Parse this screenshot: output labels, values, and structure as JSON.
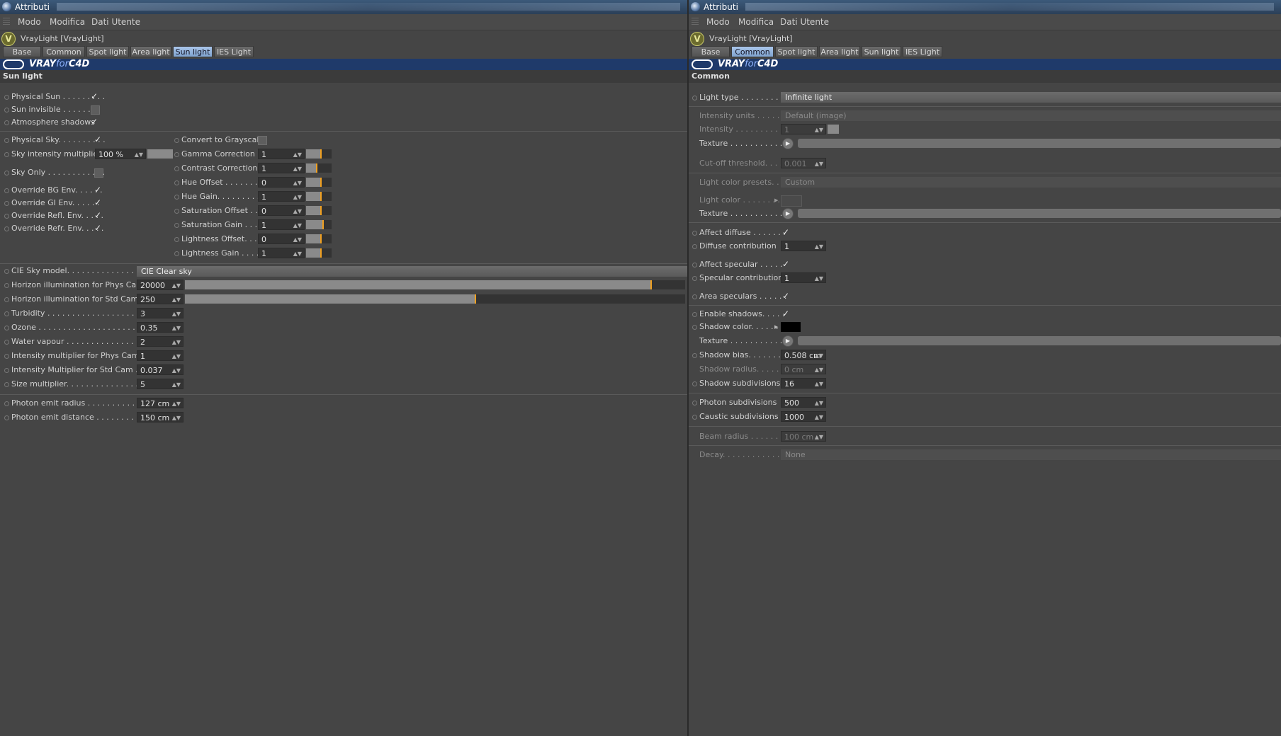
{
  "left": {
    "title": "Attributi",
    "menu": [
      "Modo",
      "Modifica",
      "Dati Utente"
    ],
    "object": "VrayLight [VrayLight]",
    "tabs": [
      "Base",
      "Common",
      "Spot light",
      "Area light",
      "Sun light",
      "IES Light"
    ],
    "active_tab": "Sun light",
    "brand": {
      "vray": "VRAY",
      "for": "for",
      "c4d": "C4D"
    },
    "section": "Sun light",
    "sun": [
      {
        "label": "Physical Sun . . . . . . . . .",
        "checked": true
      },
      {
        "label": "Sun invisible . . . . . . . .",
        "checked": false
      },
      {
        "label": "Atmosphere shadows",
        "checked": true
      }
    ],
    "sky_col": {
      "physical_sky": {
        "label": "Physical Sky. . . . . . . . . .",
        "checked": true
      },
      "sky_intensity": {
        "label": "Sky intensity multiplier",
        "value": "100 %"
      },
      "sky_only": {
        "label": "Sky Only . . . . . . . . . . . .",
        "checked": false
      },
      "overrides": [
        {
          "label": "Override BG Env. . . . . .",
          "checked": true
        },
        {
          "label": "Override GI Env. . . . . .",
          "checked": true
        },
        {
          "label": "Override Refl. Env. . . . .",
          "checked": true
        },
        {
          "label": "Override Refr. Env. . . . .",
          "checked": true
        }
      ]
    },
    "color_col": {
      "grayscale": {
        "label": "Convert to Grayscale",
        "checked": false
      },
      "params": [
        {
          "label": "Gamma Correction",
          "value": "1"
        },
        {
          "label": "Contrast Correction",
          "value": "1"
        },
        {
          "label": "Hue Offset . . . . . . . . .",
          "value": "0"
        },
        {
          "label": "Hue Gain. . . . . . . . . . .",
          "value": "1"
        },
        {
          "label": "Saturation Offset . . . .",
          "value": "0"
        },
        {
          "label": "Saturation Gain . . . . .",
          "value": "1"
        },
        {
          "label": "Lightness Offset. . . . .",
          "value": "0"
        },
        {
          "label": "Lightness Gain . . . . . .",
          "value": "1"
        }
      ]
    },
    "cie": {
      "label": "CIE Sky model. . . . . . . . . . . . . . . . . .",
      "value": "CIE Clear sky"
    },
    "atmos": [
      {
        "label": "Horizon illumination for Phys Cam",
        "value": "20000",
        "slider": 0.93
      },
      {
        "label": "Horizon illumination for Std Cam",
        "value": "250",
        "slider": 0.58
      },
      {
        "label": "Turbidity . . . . . . . . . . . . . . . . . . . . . . . .",
        "value": "3"
      },
      {
        "label": "Ozone . . . . . . . . . . . . . . . . . . . . . . . . .",
        "value": "0.35"
      },
      {
        "label": "Water vapour . . . . . . . . . . . . . . . . . . .",
        "value": "2"
      },
      {
        "label": "Intensity multiplier for Phys Cam",
        "value": "1"
      },
      {
        "label": "Intensity Multiplier for Std Cam . .",
        "value": "0.037"
      },
      {
        "label": "Size multiplier. . . . . . . . . . . . . . . . . . .",
        "value": "5"
      }
    ],
    "photon": [
      {
        "label": "Photon emit radius . . . . . . . . . . . . .",
        "value": "127 cm"
      },
      {
        "label": "Photon emit distance . . . . . . . . . . .",
        "value": "150 cm"
      }
    ]
  },
  "right": {
    "title": "Attributi",
    "menu": [
      "Modo",
      "Modifica",
      "Dati Utente"
    ],
    "object": "VrayLight [VrayLight]",
    "tabs": [
      "Base",
      "Common",
      "Spot light",
      "Area light",
      "Sun light",
      "IES Light"
    ],
    "active_tab": "Common",
    "brand": {
      "vray": "VRAY",
      "for": "for",
      "c4d": "C4D"
    },
    "section": "Common",
    "light_type": {
      "label": "Light type . . . . . . . . . .",
      "value": "Infinite light"
    },
    "intensity_units": {
      "label": "Intensity units . . . . . .",
      "value": "Default (image)"
    },
    "intensity": {
      "label": "Intensity . . . . . . . . . . .",
      "value": "1"
    },
    "texture1": {
      "label": "Texture . . . . . . . . . . . ."
    },
    "cutoff": {
      "label": "Cut-off threshold. . . .",
      "value": "0.001"
    },
    "color_presets": {
      "label": "Light color presets. . .",
      "value": "Custom"
    },
    "light_color": {
      "label": "Light color . . . . . . . ."
    },
    "texture2": {
      "label": "Texture . . . . . . . . . . . ."
    },
    "affect_diffuse": {
      "label": "Affect diffuse . . . . . . .",
      "checked": true
    },
    "diffuse_contrib": {
      "label": "Diffuse contribution",
      "value": "1"
    },
    "affect_specular": {
      "label": "Affect specular . . . . .",
      "checked": true
    },
    "specular_contrib": {
      "label": "Specular contribution",
      "value": "1"
    },
    "area_speculars": {
      "label": "Area speculars . . . . . .",
      "checked": true
    },
    "enable_shadows": {
      "label": "Enable shadows. . . . .",
      "checked": true
    },
    "shadow_color": {
      "label": "Shadow color. . . . . . ."
    },
    "texture3": {
      "label": "Texture . . . . . . . . . . . ."
    },
    "shadow_bias": {
      "label": "Shadow bias. . . . . . . .",
      "value": "0.508 cm"
    },
    "shadow_radius": {
      "label": "Shadow radius. . . . . . .",
      "value": "0 cm"
    },
    "shadow_subdiv": {
      "label": "Shadow subdivisions",
      "value": "16"
    },
    "photon_subdiv": {
      "label": "Photon subdivisions",
      "value": "500"
    },
    "caustic_subdiv": {
      "label": "Caustic subdivisions",
      "value": "1000"
    },
    "beam_radius": {
      "label": "Beam radius . . . . . . . .",
      "value": "100 cm"
    },
    "decay": {
      "label": "Decay. . . . . . . . . . . . . .",
      "value": "None"
    }
  }
}
